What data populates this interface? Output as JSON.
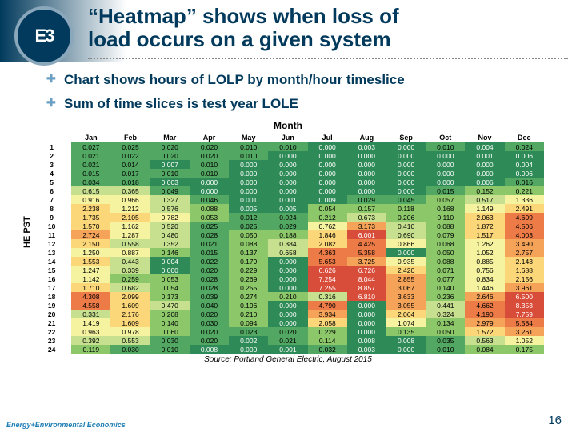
{
  "header": {
    "title_line1": "“Heatmap” shows when loss of",
    "title_line2": "load occurs on a given system",
    "logo_text": "E3"
  },
  "bullets": {
    "b1": "Chart shows hours of LOLP by month/hour timeslice",
    "b2": "Sum of time slices is test year LOLE"
  },
  "axis": {
    "xlabel": "Month",
    "ylabel": "HE PST"
  },
  "source": "Source: Portland General Electric, August 2015",
  "footer": {
    "brand": "Energy+Environmental Economics"
  },
  "pagenum": "16",
  "chart_data": {
    "type": "heatmap",
    "title": "Hours of LOLP by month/hour timeslice",
    "xlabel": "Month",
    "ylabel": "HE PST",
    "x_categories": [
      "Jan",
      "Feb",
      "Mar",
      "Apr",
      "May",
      "Jun",
      "Jul",
      "Aug",
      "Sep",
      "Oct",
      "Nov",
      "Dec"
    ],
    "y_categories": [
      1,
      2,
      3,
      4,
      5,
      6,
      7,
      8,
      9,
      10,
      11,
      12,
      13,
      14,
      15,
      16,
      17,
      18,
      19,
      20,
      21,
      22,
      23,
      24
    ],
    "grid": [
      [
        0.027,
        0.025,
        0.02,
        0.02,
        0.01,
        0.01,
        0.0,
        0.003,
        0.0,
        0.01,
        0.004,
        0.024
      ],
      [
        0.021,
        0.022,
        0.02,
        0.02,
        0.01,
        0.0,
        0.0,
        0.0,
        0.0,
        0.0,
        0.001,
        0.006
      ],
      [
        0.021,
        0.014,
        0.007,
        0.01,
        0.0,
        0.0,
        0.0,
        0.0,
        0.0,
        0.0,
        0.0,
        0.004
      ],
      [
        0.015,
        0.017,
        0.01,
        0.01,
        0.0,
        0.0,
        0.0,
        0.0,
        0.0,
        0.0,
        0.0,
        0.006
      ],
      [
        0.034,
        0.018,
        0.003,
        0.0,
        0.0,
        0.0,
        0.0,
        0.0,
        0.0,
        0.0,
        0.006,
        0.016
      ],
      [
        0.615,
        0.365,
        0.049,
        0.0,
        0.0,
        0.0,
        0.0,
        0.0,
        0.0,
        0.015,
        0.152,
        0.221
      ],
      [
        0.916,
        0.966,
        0.327,
        0.046,
        0.001,
        0.001,
        0.009,
        0.029,
        0.045,
        0.057,
        0.517,
        1.336
      ],
      [
        2.238,
        1.212,
        0.576,
        0.088,
        0.005,
        0.005,
        0.054,
        0.157,
        0.118,
        0.168,
        1.149,
        2.491
      ],
      [
        1.735,
        2.105,
        0.782,
        0.053,
        0.012,
        0.024,
        0.212,
        0.673,
        0.206,
        0.11,
        2.063,
        4.609
      ],
      [
        1.57,
        1.162,
        0.52,
        0.025,
        0.025,
        0.029,
        0.762,
        3.173,
        0.41,
        0.088,
        1.872,
        4.506
      ],
      [
        2.724,
        1.287,
        0.48,
        0.028,
        0.05,
        0.188,
        1.846,
        6.001,
        0.69,
        0.079,
        1.517,
        4.003
      ],
      [
        2.15,
        0.558,
        0.352,
        0.021,
        0.088,
        0.384,
        2.082,
        4.425,
        0.866,
        0.068,
        1.262,
        3.49
      ],
      [
        1.25,
        0.887,
        0.146,
        0.015,
        0.137,
        0.658,
        4.363,
        5.358,
        0.0,
        0.05,
        1.052,
        2.757
      ],
      [
        1.553,
        0.443,
        0.004,
        0.022,
        0.179,
        0.0,
        5.653,
        3.725,
        0.935,
        0.088,
        0.885,
        2.143
      ],
      [
        1.247,
        0.339,
        0.0,
        0.02,
        0.229,
        0.0,
        6.626,
        6.726,
        2.42,
        0.071,
        0.756,
        1.688
      ],
      [
        1.142,
        0.259,
        0.053,
        0.028,
        0.269,
        0.0,
        7.254,
        8.044,
        2.855,
        0.077,
        0.834,
        2.156
      ],
      [
        1.71,
        0.682,
        0.054,
        0.028,
        0.255,
        0.0,
        7.255,
        8.857,
        3.067,
        0.14,
        1.446,
        3.961
      ],
      [
        4.308,
        2.099,
        0.173,
        0.039,
        0.274,
        0.21,
        0.316,
        6.81,
        3.633,
        0.236,
        2.646,
        6.5
      ],
      [
        4.558,
        1.609,
        0.47,
        0.04,
        0.196,
        0.0,
        4.79,
        0.0,
        3.055,
        0.441,
        4.662,
        8.353
      ],
      [
        0.331,
        2.176,
        0.208,
        0.02,
        0.21,
        0.0,
        3.934,
        0.0,
        2.064,
        0.324,
        4.19,
        7.759
      ],
      [
        1.419,
        1.609,
        0.14,
        0.03,
        0.094,
        0.0,
        2.058,
        0.0,
        1.074,
        0.134,
        2.979,
        5.584
      ],
      [
        0.963,
        0.978,
        0.06,
        0.02,
        0.023,
        0.02,
        0.229,
        0.0,
        0.135,
        0.05,
        1.572,
        3.261
      ],
      [
        0.392,
        0.553,
        0.03,
        0.02,
        0.002,
        0.021,
        0.114,
        0.008,
        0.008,
        0.035,
        0.563,
        1.052
      ],
      [
        0.119,
        0.03,
        0.01,
        0.008,
        0.0,
        0.001,
        0.032,
        0.003,
        0.0,
        0.01,
        0.084,
        0.175
      ]
    ],
    "color_scale": "green (low) → yellow → red (high)",
    "value_range": [
      0.0,
      9.0
    ]
  }
}
